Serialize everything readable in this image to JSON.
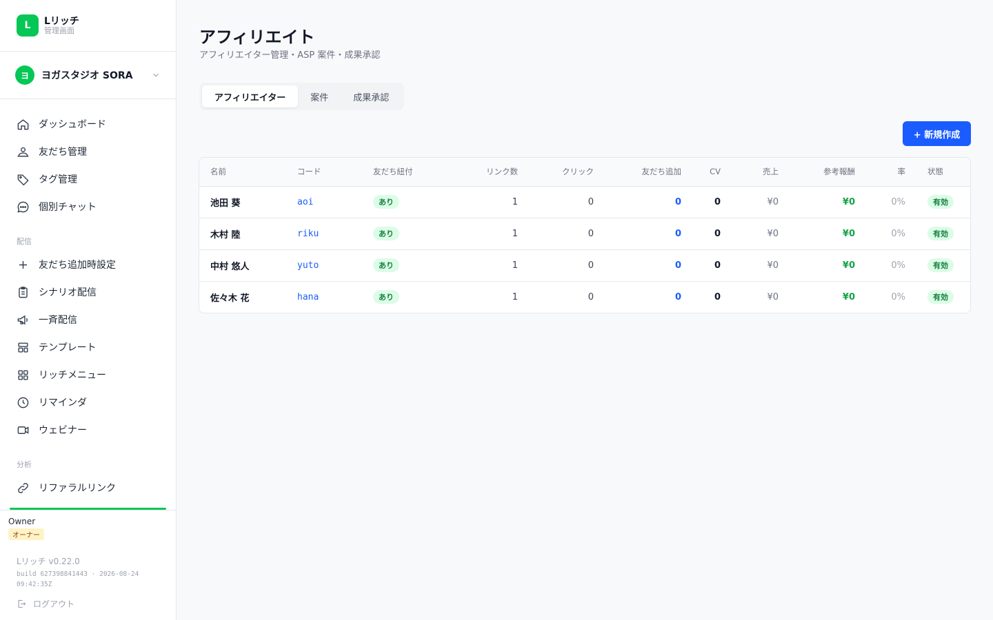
{
  "brand": {
    "logo": "L",
    "name": "Lリッチ",
    "sub": "管理画面",
    "color": "#06c755"
  },
  "account": {
    "avatar": "ヨ",
    "name": "ヨガスタジオ SORA"
  },
  "nav": {
    "main": [
      {
        "label": "ダッシュボード",
        "icon": "home-icon"
      },
      {
        "label": "友だち管理",
        "icon": "users-icon"
      },
      {
        "label": "タグ管理",
        "icon": "tag-icon"
      },
      {
        "label": "個別チャット",
        "icon": "chat-icon"
      }
    ],
    "delivery_title": "配信",
    "delivery": [
      {
        "label": "友だち追加時設定",
        "icon": "plus-icon"
      },
      {
        "label": "シナリオ配信",
        "icon": "clipboard-icon"
      },
      {
        "label": "一斉配信",
        "icon": "megaphone-icon"
      },
      {
        "label": "テンプレート",
        "icon": "template-icon"
      },
      {
        "label": "リッチメニュー",
        "icon": "grid-icon"
      },
      {
        "label": "リマインダ",
        "icon": "clock-icon"
      },
      {
        "label": "ウェビナー",
        "icon": "video-icon"
      }
    ],
    "analysis_title": "分析",
    "analysis": [
      {
        "label": "リファラルリンク",
        "icon": "link-icon"
      }
    ]
  },
  "footer": {
    "role": "Owner",
    "role_badge": "オーナー",
    "version": "Lリッチ v0.22.0",
    "build": "build 627398841443 · 2026-08-24 09:42:35Z",
    "logout": "ログアウト"
  },
  "page": {
    "title": "アフィリエイト",
    "subtitle": "アフィリエイター管理・ASP 案件・成果承認"
  },
  "tabs": [
    {
      "label": "アフィリエイター",
      "active": true
    },
    {
      "label": "案件",
      "active": false
    },
    {
      "label": "成果承認",
      "active": false
    }
  ],
  "new_button": "+ 新規作成",
  "table": {
    "headers": [
      "名前",
      "コード",
      "友だち紐付",
      "リンク数",
      "クリック",
      "友だち追加",
      "CV",
      "売上",
      "参考報酬",
      "率",
      "状態"
    ],
    "rows": [
      {
        "name": "池田 葵",
        "code": "aoi",
        "linked": "あり",
        "links": "1",
        "clicks": "0",
        "friends": "0",
        "cv": "0",
        "sales": "¥0",
        "reward": "¥0",
        "rate": "0%",
        "status": "有効"
      },
      {
        "name": "木村 陸",
        "code": "riku",
        "linked": "あり",
        "links": "1",
        "clicks": "0",
        "friends": "0",
        "cv": "0",
        "sales": "¥0",
        "reward": "¥0",
        "rate": "0%",
        "status": "有効"
      },
      {
        "name": "中村 悠人",
        "code": "yuto",
        "linked": "あり",
        "links": "1",
        "clicks": "0",
        "friends": "0",
        "cv": "0",
        "sales": "¥0",
        "reward": "¥0",
        "rate": "0%",
        "status": "有効"
      },
      {
        "name": "佐々木 花",
        "code": "hana",
        "linked": "あり",
        "links": "1",
        "clicks": "0",
        "friends": "0",
        "cv": "0",
        "sales": "¥0",
        "reward": "¥0",
        "rate": "0%",
        "status": "有効"
      }
    ]
  },
  "colors": {
    "accent": "#1a5cff",
    "green": "#06c755",
    "success": "#16a34a"
  }
}
